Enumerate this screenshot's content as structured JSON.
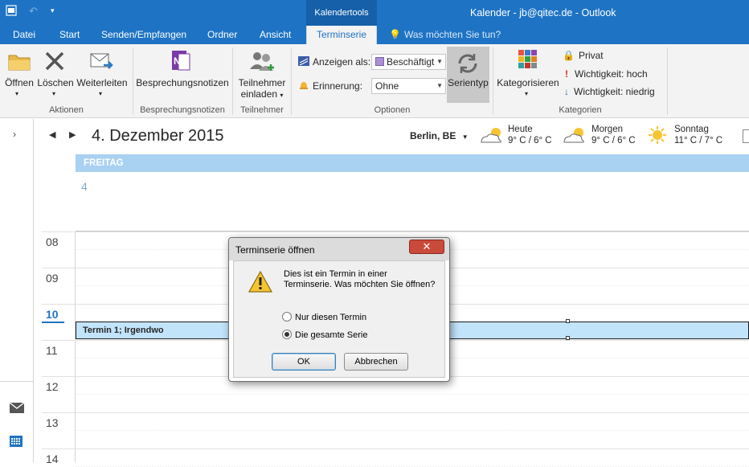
{
  "titlebar": {
    "contextual_tab": "Kalendertools",
    "window_title": "Kalender - jb@qitec.de - Outlook"
  },
  "tabs": [
    "Datei",
    "Start",
    "Senden/Empfangen",
    "Ordner",
    "Ansicht",
    "Terminserie"
  ],
  "tell_me": "Was möchten Sie tun?",
  "ribbon": {
    "actions": {
      "open": "Öffnen",
      "delete": "Löschen",
      "forward": "Weiterleiten",
      "label": "Aktionen"
    },
    "meeting_notes": {
      "button": "Besprechungsnotizen",
      "label": "Besprechungsnotizen"
    },
    "attendees": {
      "button_line1": "Teilnehmer",
      "button_line2": "einladen",
      "label": "Teilnehmer"
    },
    "options": {
      "show_as_label": "Anzeigen als:",
      "show_as_value": "Beschäftigt",
      "reminder_label": "Erinnerung:",
      "reminder_value": "Ohne",
      "recurrence": "Serientyp",
      "label": "Optionen"
    },
    "tags": {
      "categorize": "Kategorisieren",
      "private": "Privat",
      "high_importance": "Wichtigkeit: hoch",
      "low_importance": "Wichtigkeit: niedrig",
      "label": "Kategorien"
    }
  },
  "calendar": {
    "date": "4. Dezember 2015",
    "location": "Berlin, BE",
    "weather": [
      {
        "day": "Heute",
        "temp": "9° C / 6° C"
      },
      {
        "day": "Morgen",
        "temp": "9° C / 6° C"
      },
      {
        "day": "Sonntag",
        "temp": "11° C / 7° C"
      }
    ],
    "day_header": "FREITAG",
    "day_number": "4",
    "hours": [
      "08",
      "09",
      "10",
      "11",
      "12",
      "13",
      "14"
    ],
    "appointment": "Termin 1; Irgendwo"
  },
  "dialog": {
    "title": "Terminserie öffnen",
    "close": "✕",
    "message": "Dies ist ein Termin in einer Terminserie. Was möchten Sie öffnen?",
    "option_single": "Nur diesen Termin",
    "option_series": "Die gesamte Serie",
    "ok": "OK",
    "cancel": "Abbrechen"
  },
  "colors": {
    "accent": "#1e73c4",
    "day_header": "#a9d1f2",
    "appointment": "#c2e4fb",
    "busy": "#a98fd6"
  }
}
